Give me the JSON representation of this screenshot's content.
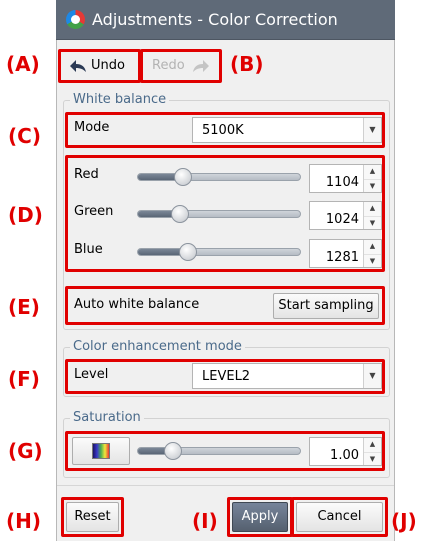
{
  "window": {
    "title": "Adjustments - Color Correction"
  },
  "toolbar": {
    "undo_label": "Undo",
    "redo_label": "Redo",
    "undo_icon": "undo-arrow-icon",
    "redo_icon": "redo-arrow-icon"
  },
  "white_balance": {
    "legend": "White balance",
    "mode_label": "Mode",
    "mode_value": "5100K",
    "sliders": [
      {
        "label": "Red",
        "value": "1104",
        "level": 0.28
      },
      {
        "label": "Green",
        "value": "1024",
        "level": 0.26
      },
      {
        "label": "Blue",
        "value": "1281",
        "level": 0.31
      }
    ],
    "auto_label": "Auto white balance",
    "sampling_button": "Start sampling"
  },
  "color_enhancement": {
    "legend": "Color enhancement mode",
    "level_label": "Level",
    "level_value": "LEVEL2"
  },
  "saturation": {
    "legend": "Saturation",
    "value": "1.00",
    "level": 0.22,
    "swatch_icon": "color-gradient-icon"
  },
  "footer": {
    "reset_label": "Reset",
    "apply_label": "Apply",
    "cancel_label": "Cancel"
  },
  "callouts": {
    "a": "(A)",
    "b": "(B)",
    "c": "(C)",
    "d": "(D)",
    "e": "(E)",
    "f": "(F)",
    "g": "(G)",
    "h": "(H)",
    "i": "(I)",
    "j": "(J)"
  },
  "colors": {
    "callout_red": "#e00000",
    "titlebar": "#5f6a78",
    "legend_text": "#4a6a8a",
    "window_bg": "#f0f0f0"
  }
}
